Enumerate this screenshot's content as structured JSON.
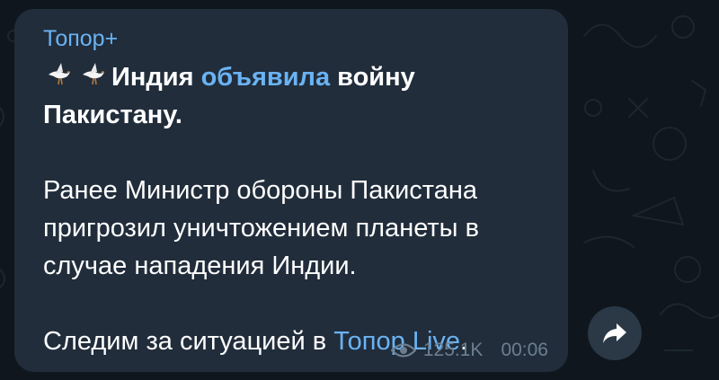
{
  "message": {
    "channel_name": "Топор+",
    "headline": {
      "emoji_1": "dove-emoji",
      "emoji_2": "dove-emoji",
      "part1": "Индия ",
      "link": "объявила",
      "part2": " войну Пакистану."
    },
    "paragraph_2": "Ранее Министр обороны Пакистана пригрозил уничтожением планеты в случае нападения Индии.",
    "paragraph_3": {
      "text": "Следим за ситуацией в ",
      "link": "Топор Live",
      "end": "."
    },
    "views": "125.1K",
    "time": "00:06"
  },
  "actions": {
    "share_icon": "share-arrow-icon"
  },
  "colors": {
    "background": "#0f161d",
    "bubble": "#212d3b",
    "accent": "#6ab3f3",
    "meta": "#6d7f8f",
    "share_button": "#2b3846"
  }
}
